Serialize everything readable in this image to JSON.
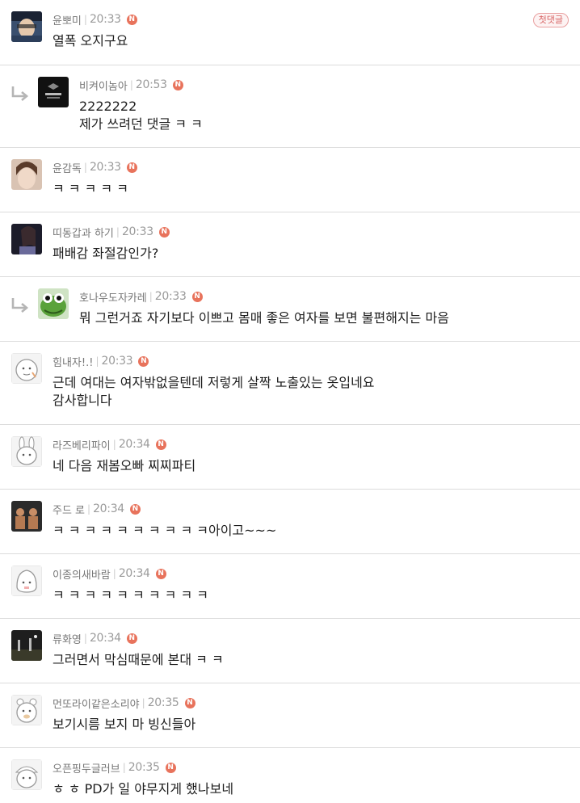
{
  "badge_icon": "n-new-badge",
  "first_comment_label": "첫댓글",
  "comments": [
    {
      "author": "윤뽀미",
      "time": "20:33",
      "text": "열폭 오지구요",
      "reply": false,
      "first": true
    },
    {
      "author": "비켜이놈아",
      "time": "20:53",
      "text": "2222222\n제가 쓰려던 댓글 ㅋ ㅋ",
      "reply": true
    },
    {
      "author": "윤감독",
      "time": "20:33",
      "text": "ㅋ ㅋ ㅋ ㅋ ㅋ",
      "reply": false
    },
    {
      "author": "띠동갑과 하기",
      "time": "20:33",
      "text": "패배감 좌절감인가?",
      "reply": false
    },
    {
      "author": "호나우도자카레",
      "time": "20:33",
      "text": "뭐 그런거죠 자기보다 이쁘고 몸매 좋은 여자를 보면 불편해지는 마음",
      "reply": true
    },
    {
      "author": "힘내자!.!",
      "time": "20:33",
      "text": "근데 여대는 여자밖없을텐데 저렇게 살짝 노출있는 옷입네요\n감사합니다",
      "reply": false
    },
    {
      "author": "라즈베리파이",
      "time": "20:34",
      "text": "네 다음 재봄오빠 찌찌파티",
      "reply": false
    },
    {
      "author": "주드 로",
      "time": "20:34",
      "text": "ㅋ ㅋ ㅋ ㅋ ㅋ ㅋ ㅋ ㅋ ㅋ ㅋ아이고~~~",
      "reply": false
    },
    {
      "author": "이종의새바람",
      "time": "20:34",
      "text": "ㅋ ㅋ ㅋ ㅋ ㅋ ㅋ ㅋ ㅋ ㅋ ㅋ",
      "reply": false
    },
    {
      "author": "류화영",
      "time": "20:34",
      "text": "그러면서 막심때문에 본대 ㅋ ㅋ",
      "reply": false
    },
    {
      "author": "먼또라이같은소리야",
      "time": "20:35",
      "text": "보기시름 보지 마 빙신들아",
      "reply": false
    },
    {
      "author": "오픈핑두글러브",
      "time": "20:35",
      "text": "ㅎ ㅎ PD가 일 야무지게 했나보네",
      "reply": false
    }
  ]
}
